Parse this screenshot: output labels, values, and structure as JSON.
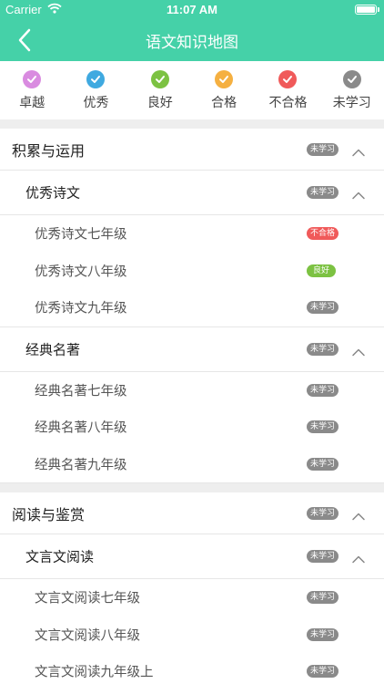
{
  "status_bar": {
    "carrier": "Carrier",
    "time": "11:07 AM"
  },
  "nav": {
    "title": "语文知识地图"
  },
  "legend": [
    {
      "label": "卓越",
      "color": "#d98be0",
      "icon": "check-circle-icon"
    },
    {
      "label": "优秀",
      "color": "#3fa9e0",
      "icon": "check-circle-icon"
    },
    {
      "label": "良好",
      "color": "#7cc242",
      "icon": "check-circle-icon"
    },
    {
      "label": "合格",
      "color": "#f5b041",
      "icon": "check-circle-icon"
    },
    {
      "label": "不合格",
      "color": "#f05a5a",
      "icon": "check-circle-icon"
    },
    {
      "label": "未学习",
      "color": "#8a8a8a",
      "icon": "check-circle-icon"
    }
  ],
  "badges": {
    "not_learned": {
      "label": "未学习",
      "color": "#8a8a8a"
    },
    "fail": {
      "label": "不合格",
      "color": "#f05a5a"
    },
    "good": {
      "label": "良好",
      "color": "#7cc242"
    }
  },
  "sections": [
    {
      "title": "积累与运用",
      "status": "未学习",
      "groups": [
        {
          "title": "优秀诗文",
          "status": "未学习",
          "items": [
            {
              "title": "优秀诗文七年级",
              "status": "不合格"
            },
            {
              "title": "优秀诗文八年级",
              "status": "良好"
            },
            {
              "title": "优秀诗文九年级",
              "status": "未学习"
            }
          ]
        },
        {
          "title": "经典名著",
          "status": "未学习",
          "items": [
            {
              "title": "经典名著七年级",
              "status": "未学习"
            },
            {
              "title": "经典名著八年级",
              "status": "未学习"
            },
            {
              "title": "经典名著九年级",
              "status": "未学习"
            }
          ]
        }
      ]
    },
    {
      "title": "阅读与鉴赏",
      "status": "未学习",
      "groups": [
        {
          "title": "文言文阅读",
          "status": "未学习",
          "items": [
            {
              "title": "文言文阅读七年级",
              "status": "未学习"
            },
            {
              "title": "文言文阅读八年级",
              "status": "未学习"
            },
            {
              "title": "文言文阅读九年级上",
              "status": "未学习"
            }
          ]
        }
      ]
    }
  ]
}
